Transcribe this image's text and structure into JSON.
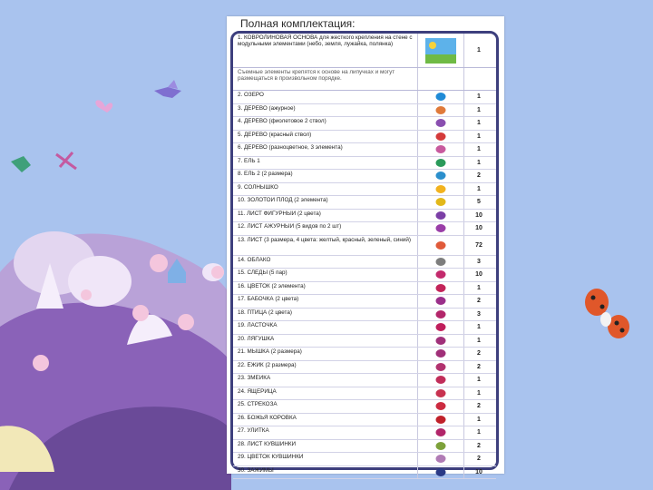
{
  "document": {
    "title": "Полная комплектация:",
    "header_item": {
      "label": "1. КОВРОЛИНОВАЯ ОСНОВА для жесткого крепления на стене с модульными элементами (небо, земля, лужайка, полянка)",
      "icon": "landscape-icon",
      "qty": "1"
    },
    "note": "Съемные элементы крепятся к основе на липучках и могут размещаться в произвольном порядке.",
    "items": [
      {
        "label": "2. ОЗЕРО",
        "icon": "lake-icon",
        "qty": "1"
      },
      {
        "label": "3. ДЕРЕВО (ажурное)",
        "icon": "tree-icon",
        "qty": "1"
      },
      {
        "label": "4. ДЕРЕВО (фиолетовое 2 ствол)",
        "icon": "tree-icon",
        "qty": "1"
      },
      {
        "label": "5. ДЕРЕВО (красный ствол)",
        "icon": "tree-icon",
        "qty": "1"
      },
      {
        "label": "6. ДЕРЕВО (разноцветное, 3 элемента)",
        "icon": "tree-icon",
        "qty": "1"
      },
      {
        "label": "7. ЕЛЬ 1",
        "icon": "fir-icon",
        "qty": "1"
      },
      {
        "label": "8. ЕЛЬ 2 (2 размера)",
        "icon": "fir-icon",
        "qty": "2"
      },
      {
        "label": "9. СОЛНЫШКО",
        "icon": "sun-icon",
        "qty": "1"
      },
      {
        "label": "10. ЗОЛОТОЙ ПЛОД (2 элемента)",
        "icon": "fruit-icon",
        "qty": "5"
      },
      {
        "label": "11. ЛИСТ ФИГУРНЫЙ (2 цвета)",
        "icon": "leaf-icon",
        "qty": "10"
      },
      {
        "label": "12. ЛИСТ АЖУРНЫЙ (5 видов по 2 шт)",
        "icon": "leaf-icon",
        "qty": "10"
      },
      {
        "label": "13. ЛИСТ (3 размера, 4 цвета: желтый, красный, зеленый, синий)",
        "icon": "leaf-icon",
        "qty": "72",
        "tall": true
      },
      {
        "label": "14. ОБЛАКО",
        "icon": "cloud-icon",
        "qty": "3"
      },
      {
        "label": "15. СЛЕДЫ (5 пар)",
        "icon": "footprints-icon",
        "qty": "10"
      },
      {
        "label": "16. ЦВЕТОК (2 элемента)",
        "icon": "flower-icon",
        "qty": "1"
      },
      {
        "label": "17. БАБОЧКА (2 цвета)",
        "icon": "butterfly-icon",
        "qty": "2"
      },
      {
        "label": "18. ПТИЦА (2 цвета)",
        "icon": "bird-icon",
        "qty": "3"
      },
      {
        "label": "19. ЛАСТОЧКА",
        "icon": "swallow-icon",
        "qty": "1"
      },
      {
        "label": "20. ЛЯГУШКА",
        "icon": "frog-icon",
        "qty": "1"
      },
      {
        "label": "21. МЫШКА (2 размера)",
        "icon": "mouse-icon",
        "qty": "2"
      },
      {
        "label": "22. ЁЖИК (2 размера)",
        "icon": "hedgehog-icon",
        "qty": "2"
      },
      {
        "label": "23. ЗМЕЙКА",
        "icon": "snake-icon",
        "qty": "1"
      },
      {
        "label": "24. ЯЩЕРИЦА",
        "icon": "lizard-icon",
        "qty": "1"
      },
      {
        "label": "25. СТРЕКОЗА",
        "icon": "dragonfly-icon",
        "qty": "2"
      },
      {
        "label": "26. БОЖЬЯ КОРОВКА",
        "icon": "ladybug-icon",
        "qty": "1"
      },
      {
        "label": "27. УЛИТКА",
        "icon": "snail-icon",
        "qty": "1"
      },
      {
        "label": "28. ЛИСТ КУВШИНКИ",
        "icon": "lily-pad-icon",
        "qty": "2"
      },
      {
        "label": "29. ЦВЕТОК КУВШИНКИ",
        "icon": "water-lily-icon",
        "qty": "2"
      },
      {
        "label": "30. ЗАЖИМЫ",
        "icon": "clip-icon",
        "qty": "10"
      }
    ]
  },
  "colors": {
    "background": "#a9c3ee",
    "frame": "#3d3f7d",
    "lilac": "#b9a2d8",
    "purple": "#8a62b8",
    "pink": "#f4c6dd",
    "crimson": "#b5245f",
    "ladybug": "#e0572a"
  },
  "icon_colors": [
    "#1f8ad6",
    "#e07a3a",
    "#8a4fb0",
    "#d43a3a",
    "#c85a9e",
    "#2a9a5a",
    "#2b8fcc",
    "#f2b21e",
    "#e2b81a",
    "#7b3fa6",
    "#9a3ea8",
    "#e05a3a",
    "#7d7d7d",
    "#c32a6c",
    "#c3245a",
    "#9b2f8a",
    "#b3266a",
    "#c01e5c",
    "#a0307a",
    "#a02f78",
    "#b2326f",
    "#c12d5a",
    "#c83250",
    "#cc2b40",
    "#c0202a",
    "#b2266a",
    "#7da13a",
    "#b07bb5",
    "#2b3a86"
  ]
}
